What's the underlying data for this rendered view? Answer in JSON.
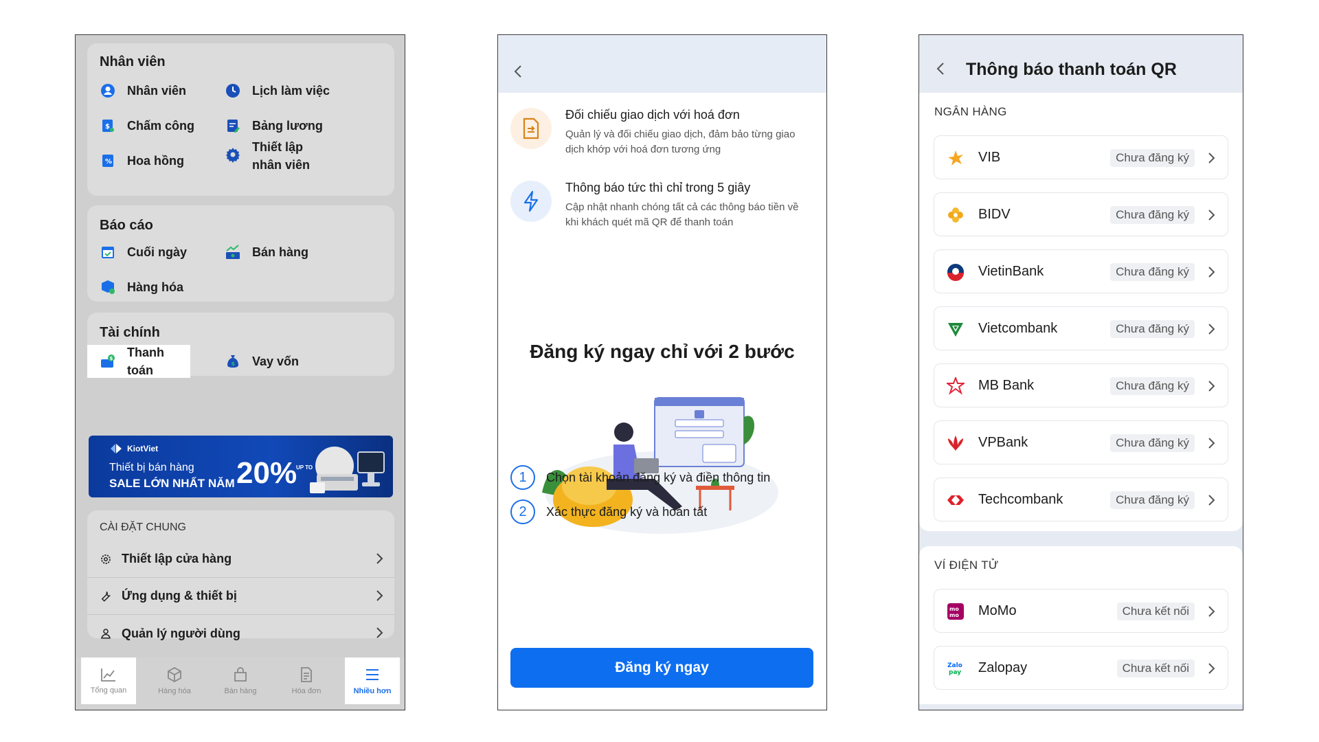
{
  "screen1": {
    "staff": {
      "title": "Nhân viên",
      "items": [
        "Nhân viên",
        "Lịch làm việc",
        "Chấm công",
        "Bảng lương",
        "Hoa hồng",
        "Thiết lập nhân viên"
      ]
    },
    "reports": {
      "title": "Báo cáo",
      "items": [
        "Cuối ngày",
        "Bán hàng",
        "Hàng hóa"
      ]
    },
    "finance": {
      "title": "Tài chính",
      "items": [
        "Thanh toán",
        "Vay vốn"
      ]
    },
    "banner": {
      "brand": "KiotViet",
      "subtitle": "Thiết bị bán hàng",
      "sale": "SALE LỚN NHẤT NĂM",
      "upto": "UP TO",
      "percent": "20%"
    },
    "settings": {
      "title": "CÀI ĐẶT CHUNG",
      "items": [
        "Thiết lập cửa hàng",
        "Ứng dụng & thiết bị",
        "Quản lý người dùng"
      ]
    },
    "tabs": [
      "Tổng quan",
      "Hàng hóa",
      "Bán hàng",
      "Hóa đơn",
      "Nhiều hơn"
    ],
    "active_tab": "Nhiều hơn"
  },
  "screen2": {
    "features": [
      {
        "title": "Đối chiếu giao dịch với hoá đơn",
        "desc": "Quản lý và đối chiếu giao dịch, đảm bảo từng giao dịch khớp với hoá đơn tương ứng"
      },
      {
        "title": "Thông báo tức thì chỉ trong 5 giây",
        "desc": "Cập nhật nhanh chóng tất cả các thông báo tiền về khi khách quét mã QR để thanh toán"
      }
    ],
    "heading": "Đăng ký ngay chỉ với 2 bước",
    "steps": [
      {
        "num": "1",
        "text": "Chọn tài khoản đăng ký và điền thông tin"
      },
      {
        "num": "2",
        "text": "Xác thực đăng ký và hoàn tất"
      }
    ],
    "cta": "Đăng ký ngay"
  },
  "screen3": {
    "title": "Thông báo thanh toán QR",
    "banks_label": "NGÂN HÀNG",
    "banks": [
      {
        "name": "VIB",
        "status": "Chưa đăng ký"
      },
      {
        "name": "BIDV",
        "status": "Chưa đăng ký"
      },
      {
        "name": "VietinBank",
        "status": "Chưa đăng ký"
      },
      {
        "name": "Vietcombank",
        "status": "Chưa đăng ký"
      },
      {
        "name": "MB Bank",
        "status": "Chưa đăng ký"
      },
      {
        "name": "VPBank",
        "status": "Chưa đăng ký"
      },
      {
        "name": "Techcombank",
        "status": "Chưa đăng ký"
      }
    ],
    "wallets_label": "VÍ ĐIỆN TỬ",
    "wallets": [
      {
        "name": "MoMo",
        "status": "Chưa kết nối",
        "logo_text": "mo mo"
      },
      {
        "name": "Zalopay",
        "status": "Chưa kết nối",
        "logo_text": "Zalo pay"
      }
    ]
  },
  "colors": {
    "primary": "#0d6ef0",
    "accent_orange": "#f5a623",
    "overlay_gray": "#cfcfcf",
    "header_blue": "#e6ecf5"
  }
}
